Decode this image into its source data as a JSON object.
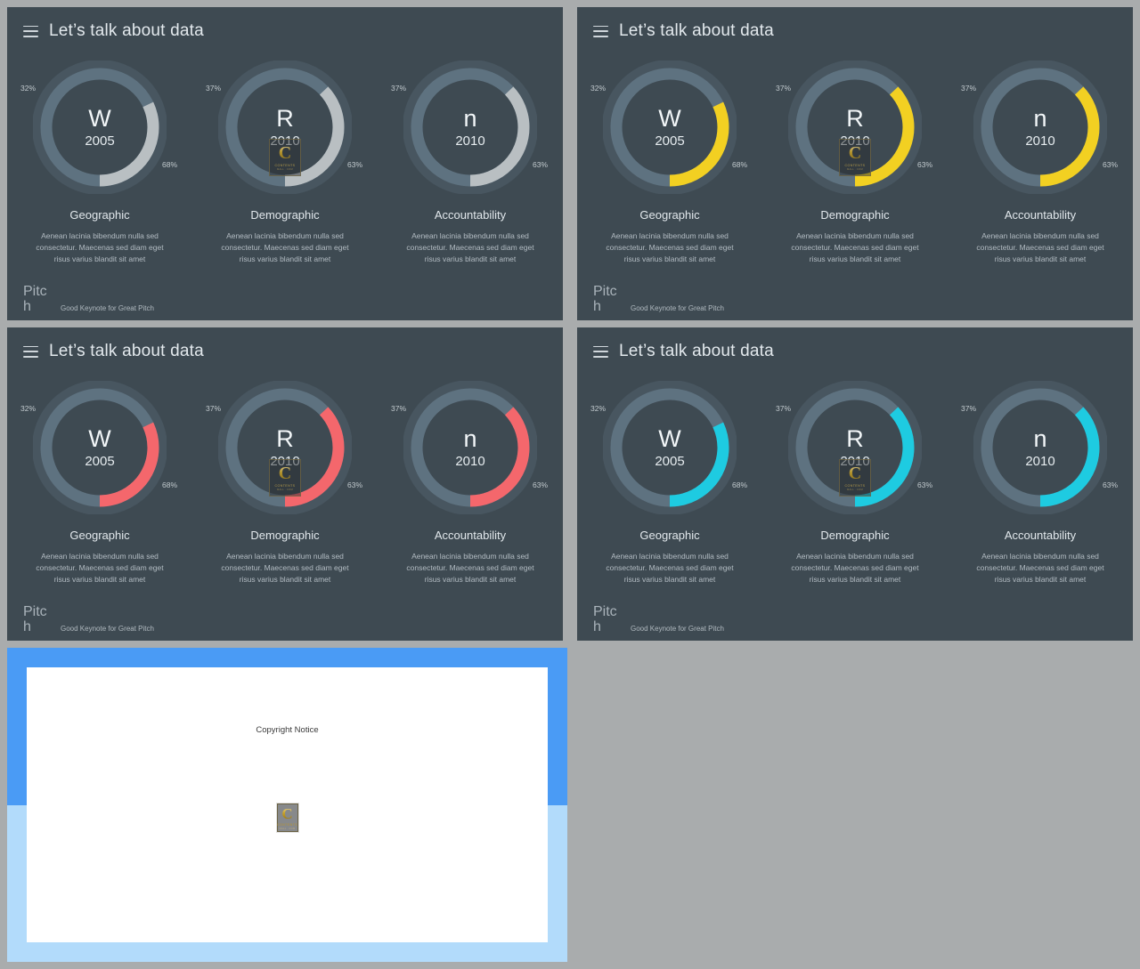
{
  "theme": {
    "slide_bg": "#3e4a52",
    "page_bg": "#a9acad",
    "track_color": "#5e7280",
    "text_primary": "#e3e9ed",
    "text_muted": "#b3bcc3"
  },
  "header": {
    "menu_icon": "hamburger-icon",
    "title": "Let’s talk about data"
  },
  "footer": {
    "brand": "Pitch",
    "tagline": "Good Keynote for Great Pitch"
  },
  "watermark": {
    "letter": "C",
    "line1": "CONTENTS",
    "line2": "MALL . COM"
  },
  "slides": [
    {
      "name": "slide-gray",
      "accent": "#b9bfc2",
      "accent_label": "gray"
    },
    {
      "name": "slide-yellow",
      "accent": "#f2d022",
      "accent_label": "yellow"
    },
    {
      "name": "slide-red",
      "accent": "#f4676c",
      "accent_label": "red"
    },
    {
      "name": "slide-cyan",
      "accent": "#1ecbe1",
      "accent_label": "cyan"
    }
  ],
  "charts": [
    {
      "heading": "Geographic",
      "letter": "W",
      "year": "2005",
      "left_pct": "32%",
      "right_pct": "68%",
      "body": "Aenean lacinia bibendum nulla sed consectetur. Maecenas sed diam eget risus varius blandit sit amet",
      "watermarked": false
    },
    {
      "heading": "Demographic",
      "letter": "R",
      "year": "2010",
      "left_pct": "37%",
      "right_pct": "63%",
      "body": "Aenean lacinia bibendum nulla sed consectetur. Maecenas sed diam eget risus varius blandit sit amet",
      "watermarked": true
    },
    {
      "heading": "Accountability",
      "letter": "n",
      "year": "2010",
      "left_pct": "37%",
      "right_pct": "63%",
      "body": "Aenean lacinia bibendum nulla sed consectetur. Maecenas sed diam eget risus varius blandit sit amet",
      "watermarked": false
    }
  ],
  "copyright_slide": {
    "name": "copyright-slide",
    "notice": "Copyright Notice",
    "border_top_color": "#4a9bf5",
    "border_bottom_color": "#b2dbfb",
    "page_color": "#ffffff"
  },
  "chart_data": {
    "type": "pie",
    "title": "Let’s talk about data",
    "note": "Three donut (ring) charts repeated across four color variants. Each ring shows a two-part split; the accent arc is drawn counter-clockwise from 12 o’clock.",
    "legend_position": "none",
    "charts": [
      {
        "label": "Geographic",
        "center_letter": "W",
        "center_year": "2005",
        "slices": [
          {
            "name": "accent",
            "value": 32,
            "label": "32%"
          },
          {
            "name": "track",
            "value": 68,
            "label": "68%"
          }
        ]
      },
      {
        "label": "Demographic",
        "center_letter": "R",
        "center_year": "2010",
        "slices": [
          {
            "name": "accent",
            "value": 37,
            "label": "37%"
          },
          {
            "name": "track",
            "value": 63,
            "label": "63%"
          }
        ]
      },
      {
        "label": "Accountability",
        "center_letter": "n",
        "center_year": "2010",
        "slices": [
          {
            "name": "accent",
            "value": 37,
            "label": "37%"
          },
          {
            "name": "track",
            "value": 63,
            "label": "63%"
          }
        ]
      }
    ],
    "series_variants": [
      {
        "name": "gray",
        "color": "#b9bfc2"
      },
      {
        "name": "yellow",
        "color": "#f2d022"
      },
      {
        "name": "red",
        "color": "#f4676c"
      },
      {
        "name": "cyan",
        "color": "#1ecbe1"
      }
    ]
  }
}
